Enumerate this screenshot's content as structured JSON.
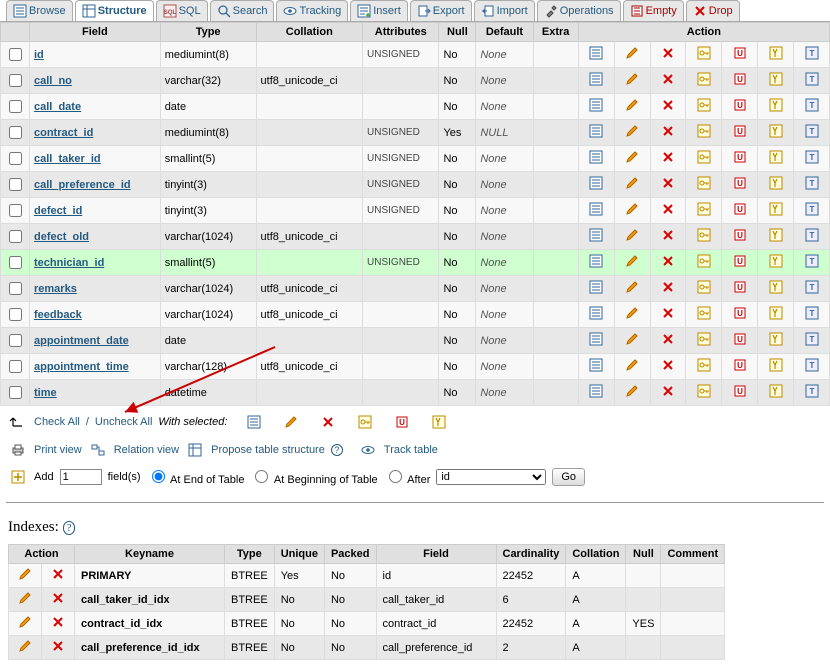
{
  "tabs": [
    {
      "label": "Browse",
      "icon": "browse"
    },
    {
      "label": "Structure",
      "icon": "structure",
      "active": true
    },
    {
      "label": "SQL",
      "icon": "sql"
    },
    {
      "label": "Search",
      "icon": "search"
    },
    {
      "label": "Tracking",
      "icon": "tracking"
    },
    {
      "label": "Insert",
      "icon": "insert"
    },
    {
      "label": "Export",
      "icon": "export"
    },
    {
      "label": "Import",
      "icon": "import"
    },
    {
      "label": "Operations",
      "icon": "operations"
    },
    {
      "label": "Empty",
      "icon": "empty",
      "red": true
    },
    {
      "label": "Drop",
      "icon": "drop",
      "red": true
    }
  ],
  "columns_header": {
    "checkbox": "",
    "field": "Field",
    "type": "Type",
    "collation": "Collation",
    "attributes": "Attributes",
    "null": "Null",
    "default": "Default",
    "extra": "Extra",
    "action": "Action"
  },
  "rows": [
    {
      "field": "id",
      "type": "mediumint(8)",
      "collation": "",
      "attr": "UNSIGNED",
      "null": "No",
      "def": "None",
      "extra": ""
    },
    {
      "field": "call_no",
      "type": "varchar(32)",
      "collation": "utf8_unicode_ci",
      "attr": "",
      "null": "No",
      "def": "None",
      "extra": ""
    },
    {
      "field": "call_date",
      "type": "date",
      "collation": "",
      "attr": "",
      "null": "No",
      "def": "None",
      "extra": ""
    },
    {
      "field": "contract_id",
      "type": "mediumint(8)",
      "collation": "",
      "attr": "UNSIGNED",
      "null": "Yes",
      "def": "NULL",
      "extra": ""
    },
    {
      "field": "call_taker_id",
      "type": "smallint(5)",
      "collation": "",
      "attr": "UNSIGNED",
      "null": "No",
      "def": "None",
      "extra": ""
    },
    {
      "field": "call_preference_id",
      "type": "tinyint(3)",
      "collation": "",
      "attr": "UNSIGNED",
      "null": "No",
      "def": "None",
      "extra": ""
    },
    {
      "field": "defect_id",
      "type": "tinyint(3)",
      "collation": "",
      "attr": "UNSIGNED",
      "null": "No",
      "def": "None",
      "extra": ""
    },
    {
      "field": "defect_old",
      "type": "varchar(1024)",
      "collation": "utf8_unicode_ci",
      "attr": "",
      "null": "No",
      "def": "None",
      "extra": ""
    },
    {
      "field": "technician_id",
      "type": "smallint(5)",
      "collation": "",
      "attr": "UNSIGNED",
      "null": "No",
      "def": "None",
      "extra": "",
      "hl": true
    },
    {
      "field": "remarks",
      "type": "varchar(1024)",
      "collation": "utf8_unicode_ci",
      "attr": "",
      "null": "No",
      "def": "None",
      "extra": ""
    },
    {
      "field": "feedback",
      "type": "varchar(1024)",
      "collation": "utf8_unicode_ci",
      "attr": "",
      "null": "No",
      "def": "None",
      "extra": ""
    },
    {
      "field": "appointment_date",
      "type": "date",
      "collation": "",
      "attr": "",
      "null": "No",
      "def": "None",
      "extra": ""
    },
    {
      "field": "appointment_time",
      "type": "varchar(128)",
      "collation": "utf8_unicode_ci",
      "attr": "",
      "null": "No",
      "def": "None",
      "extra": ""
    },
    {
      "field": "time",
      "type": "datetime",
      "collation": "",
      "attr": "",
      "null": "No",
      "def": "None",
      "extra": ""
    }
  ],
  "footer": {
    "check_all": "Check All",
    "uncheck_all": "Uncheck All",
    "with_selected": "With selected:"
  },
  "links": {
    "print_view": "Print view",
    "relation_view": "Relation view",
    "propose": "Propose table structure",
    "track": "Track table"
  },
  "add": {
    "prefix": "Add",
    "count": "1",
    "suffix": "field(s)",
    "opt_end": "At End of Table",
    "opt_begin": "At Beginning of Table",
    "opt_after": "After",
    "after_field": "id",
    "go": "Go"
  },
  "indexes_title": "Indexes:",
  "idx_header": {
    "action": "Action",
    "keyname": "Keyname",
    "type": "Type",
    "unique": "Unique",
    "packed": "Packed",
    "field": "Field",
    "cardinality": "Cardinality",
    "collation": "Collation",
    "null": "Null",
    "comment": "Comment"
  },
  "idx_rows": [
    {
      "keyname": "PRIMARY",
      "type": "BTREE",
      "unique": "Yes",
      "packed": "No",
      "field": "id",
      "card": "22452",
      "collation": "A",
      "null": "",
      "comment": ""
    },
    {
      "keyname": "call_taker_id_idx",
      "type": "BTREE",
      "unique": "No",
      "packed": "No",
      "field": "call_taker_id",
      "card": "6",
      "collation": "A",
      "null": "",
      "comment": ""
    },
    {
      "keyname": "contract_id_idx",
      "type": "BTREE",
      "unique": "No",
      "packed": "No",
      "field": "contract_id",
      "card": "22452",
      "collation": "A",
      "null": "YES",
      "comment": ""
    },
    {
      "keyname": "call_preference_id_idx",
      "type": "BTREE",
      "unique": "No",
      "packed": "No",
      "field": "call_preference_id",
      "card": "2",
      "collation": "A",
      "null": "",
      "comment": ""
    }
  ]
}
